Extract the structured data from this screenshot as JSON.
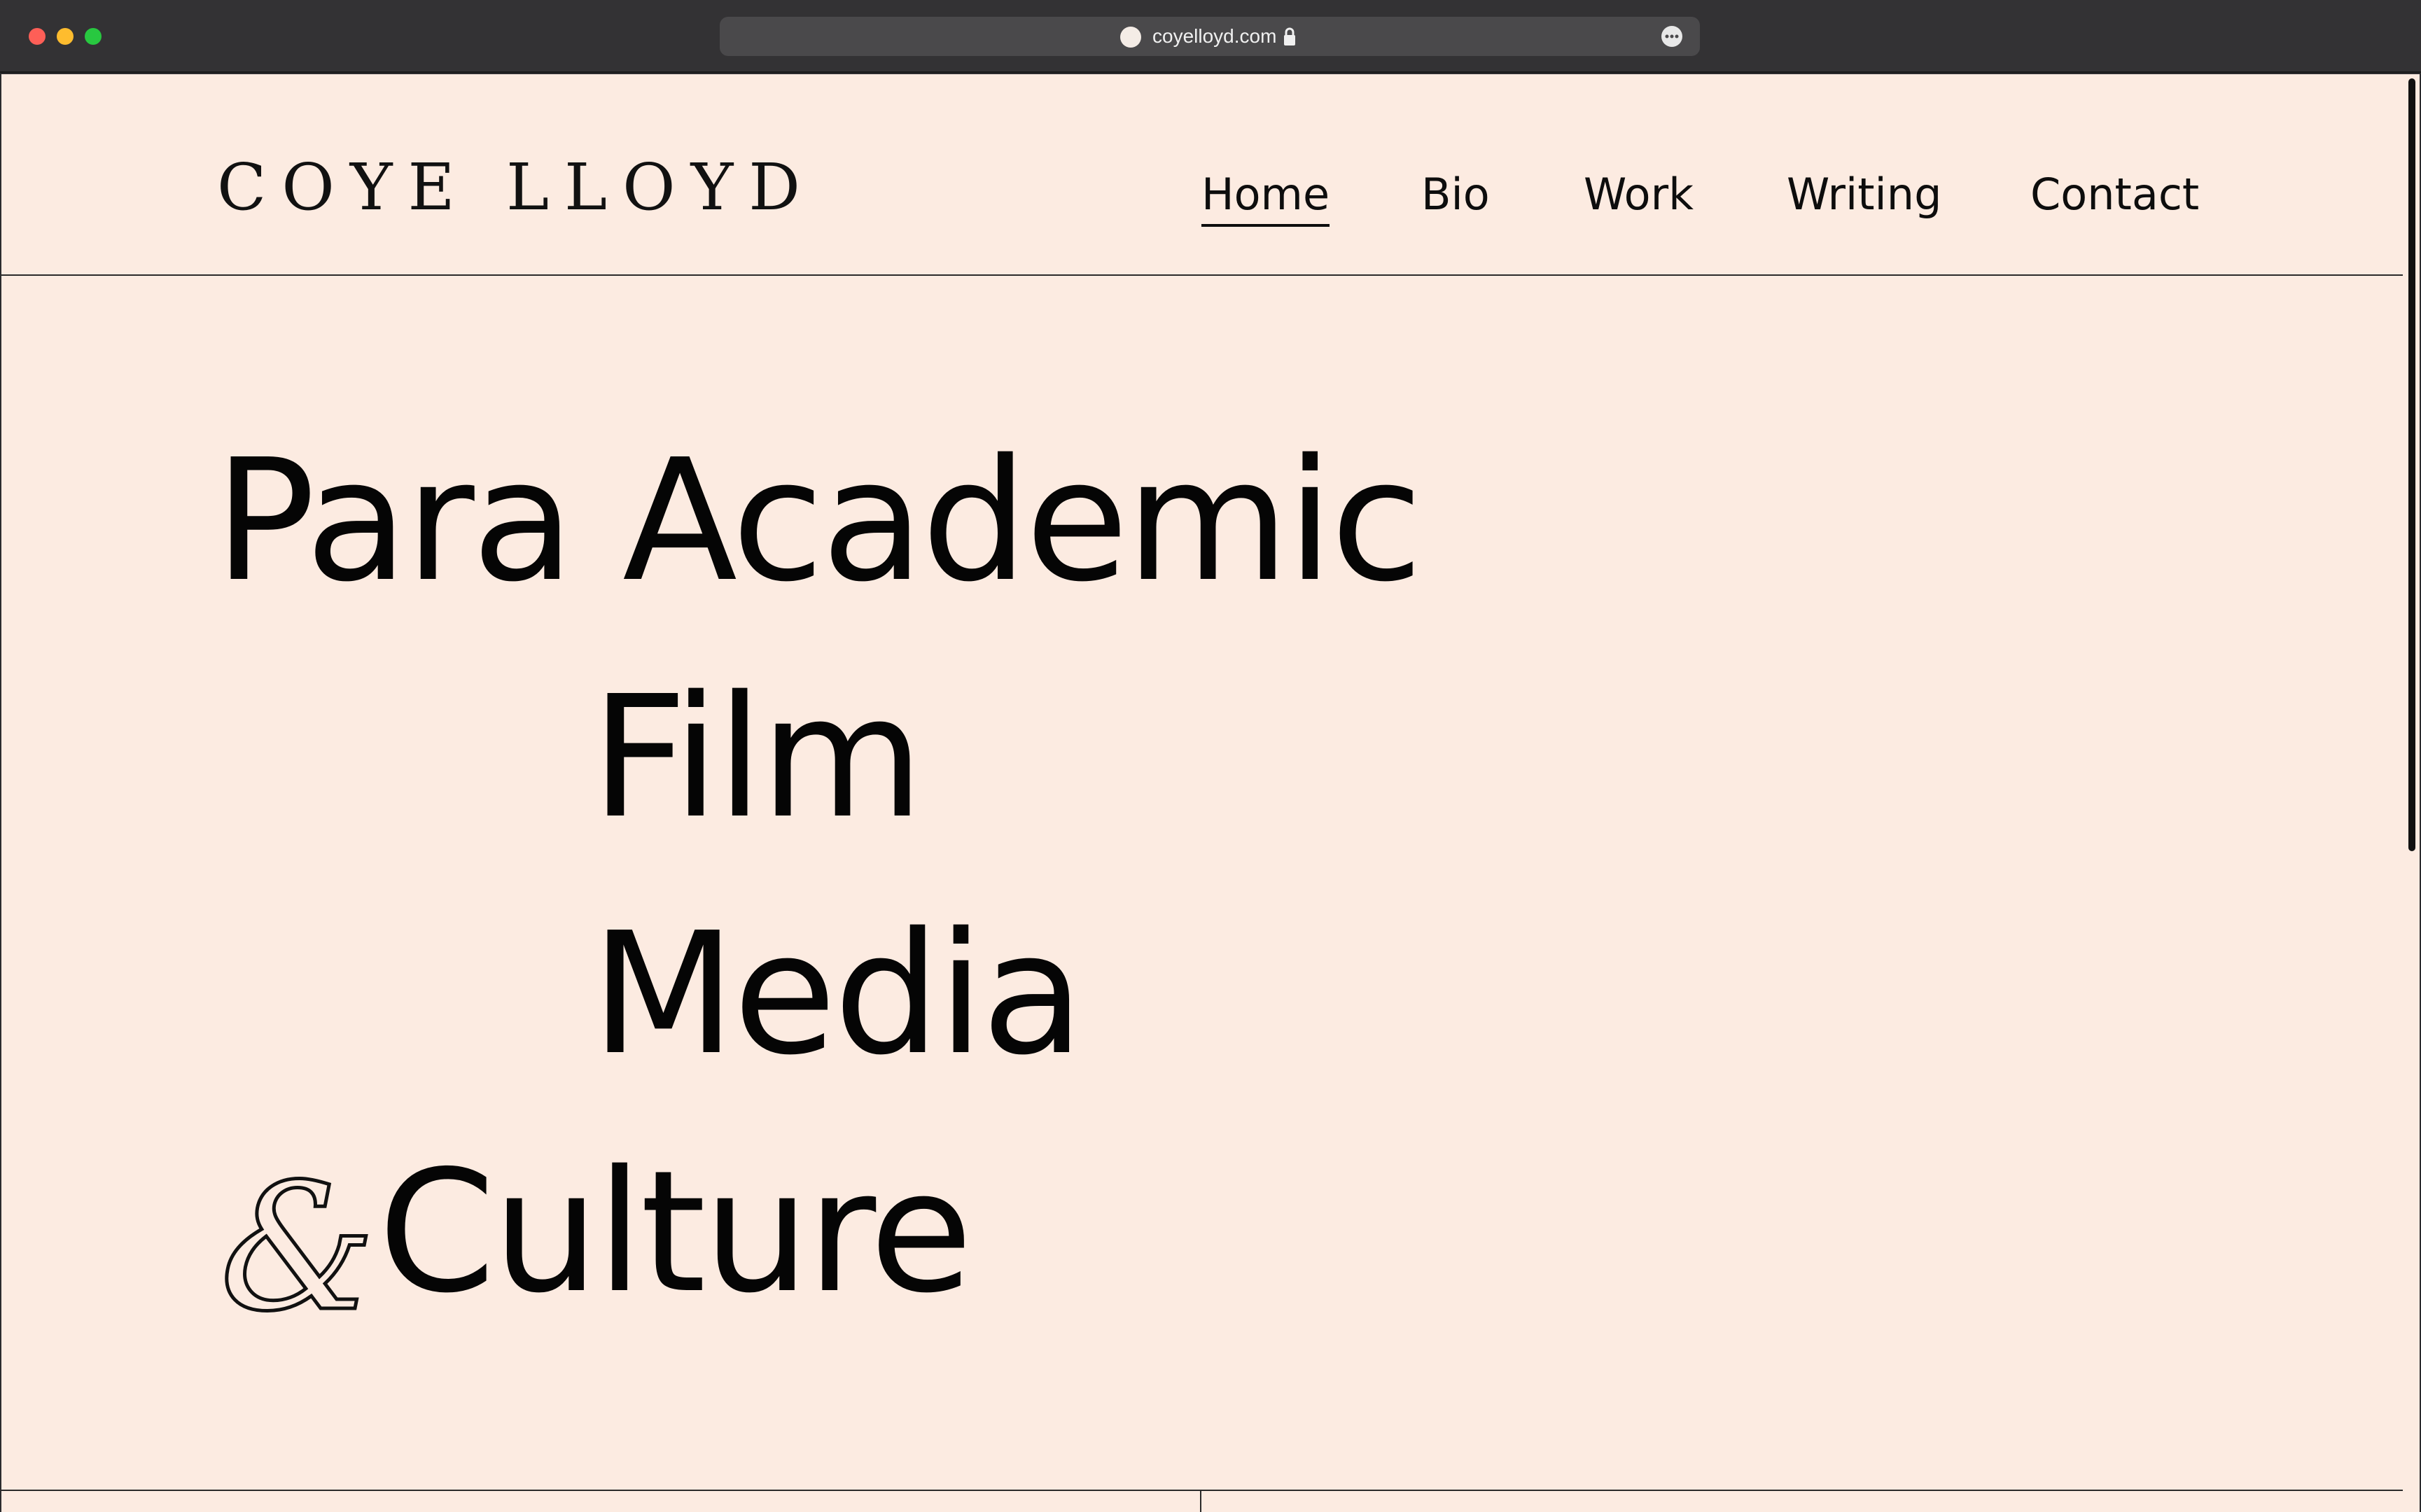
{
  "browser": {
    "url": "coyelloyd.com",
    "icons": [
      "close-icon",
      "minimize-icon",
      "zoom-icon",
      "favicon",
      "lock-icon",
      "more-icon"
    ]
  },
  "site": {
    "logo": "COYE LLOYD",
    "nav": [
      {
        "label": "Home",
        "active": true
      },
      {
        "label": "Bio",
        "active": false
      },
      {
        "label": "Work",
        "active": false
      },
      {
        "label": "Writing",
        "active": false
      },
      {
        "label": "Contact",
        "active": false
      }
    ]
  },
  "hero": {
    "line1": "Para Academic",
    "line2": "Film",
    "line3": "Media",
    "ampersand": "&",
    "line4": "Culture"
  },
  "colors": {
    "page_background": "#fcebe1",
    "text": "#050505",
    "chrome": "#333234"
  }
}
